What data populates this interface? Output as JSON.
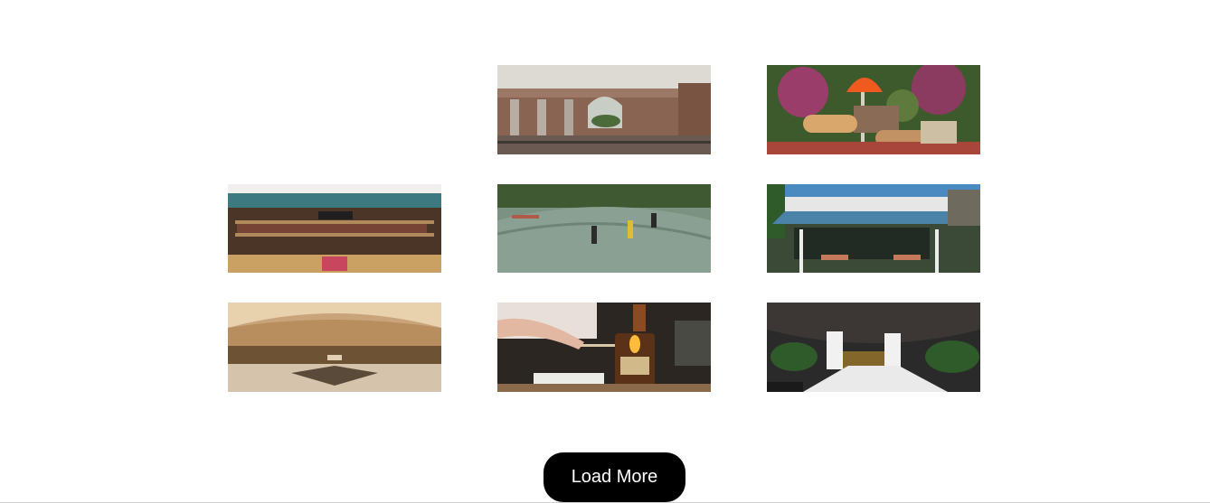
{
  "gallery": {
    "tiles": [
      {
        "slot": "empty"
      },
      {
        "image": "roman-ruins-arches-image"
      },
      {
        "image": "playground-slides-image"
      },
      {
        "image": "market-stall-shop-image"
      },
      {
        "image": "skatepark-bowl-image"
      },
      {
        "image": "cafe-awning-terrace-image"
      },
      {
        "image": "ornate-hall-interior-image"
      },
      {
        "image": "candle-lighting-match-image"
      },
      {
        "image": "lava-cave-white-pillars-image"
      }
    ]
  },
  "actions": {
    "load_more_label": "Load More"
  }
}
